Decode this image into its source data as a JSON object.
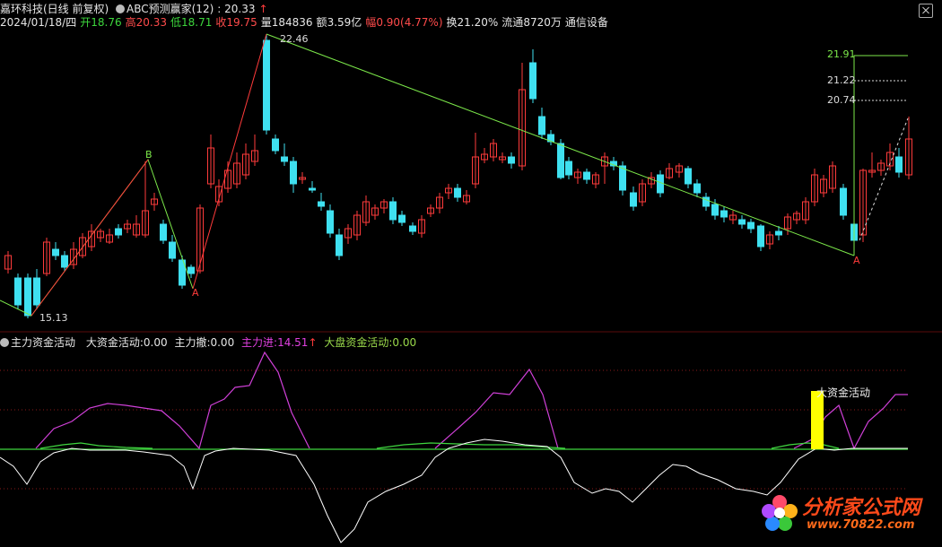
{
  "header": {
    "stock_name": "嘉环科技(日线 前复权)",
    "indicator": "ABC预测赢家(12)",
    "indicator_value": ": 20.33",
    "date": "2024/01/18/四",
    "open_label": "开",
    "open": "18.76",
    "high_label": "高",
    "high": "20.33",
    "low_label": "低",
    "low": "18.71",
    "close_label": "收",
    "close": "19.75",
    "volume_label": "量",
    "volume": "184836",
    "amount_label": "额",
    "amount": "3.59亿",
    "change_label": "幅",
    "change": "0.90(4.77%)",
    "turnover_label": "换",
    "turnover": "21.20%",
    "float_label": "流通",
    "float": "8720万",
    "industry": "通信设备"
  },
  "sub_header": {
    "title": "主力资金活动",
    "big_label": "大资金活动:",
    "big_value": "0.00",
    "withdraw_label": "主力撤:",
    "withdraw_value": "0.00",
    "inflow_label": "主力进:",
    "inflow_value": "14.51",
    "market_label": "大盘资金活动:",
    "market_value": "0.00"
  },
  "price_labels": {
    "high_point": "22.46",
    "low_point": "15.13",
    "target_1": "21.91",
    "target_2": "21.22",
    "target_3": "20.74",
    "wave_a": "A",
    "wave_b": "B"
  },
  "annotation": "大资金活动",
  "watermark": {
    "line1": "分析家公式网",
    "line2": "www.70822.com"
  },
  "colors": {
    "up": "#ff3b3b",
    "down": "#3fe0f0",
    "wave_green": "#7ce84a",
    "wave_red": "#ff3b3b",
    "magenta": "#d040d8",
    "white_line": "#ffffff",
    "bar_yellow": "#ffff00",
    "grid_red": "#8a1a1a"
  }
}
